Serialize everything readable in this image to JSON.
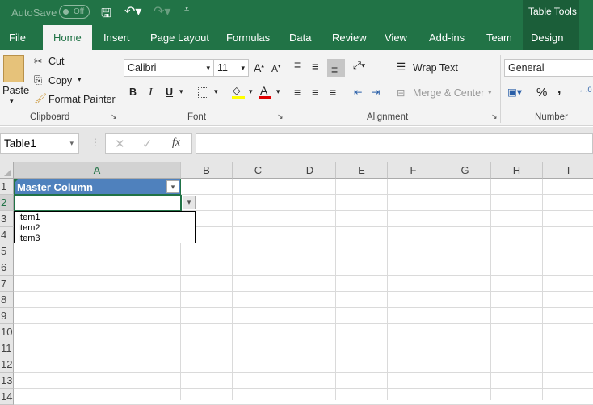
{
  "titlebar": {
    "autosave_label": "AutoSave",
    "autosave_state": "Off",
    "context_title": "Table Tools"
  },
  "tabs": [
    "File",
    "Home",
    "Insert",
    "Page Layout",
    "Formulas",
    "Data",
    "Review",
    "View",
    "Add-ins",
    "Team",
    "Design"
  ],
  "ribbon": {
    "clipboard": {
      "paste": "Paste",
      "cut": "Cut",
      "copy": "Copy",
      "format_painter": "Format Painter",
      "label": "Clipboard"
    },
    "font": {
      "name": "Calibri",
      "size": "11",
      "bold": "B",
      "italic": "I",
      "underline": "U",
      "label": "Font"
    },
    "alignment": {
      "wrap_text": "Wrap Text",
      "merge_center": "Merge & Center",
      "label": "Alignment"
    },
    "number": {
      "format": "General",
      "percent": "%",
      "comma": ",",
      "label": "Number"
    }
  },
  "formula_bar": {
    "name_box": "Table1",
    "fx": "fx",
    "value": ""
  },
  "columns": [
    "A",
    "B",
    "C",
    "D",
    "E",
    "F",
    "G",
    "H",
    "I"
  ],
  "rows": [
    "1",
    "2",
    "3",
    "4",
    "5",
    "6",
    "7",
    "8",
    "9",
    "10",
    "11",
    "12",
    "13",
    "14"
  ],
  "cells": {
    "A1": "Master Column",
    "A2": ""
  },
  "dropdown": {
    "items": [
      "Item1",
      "Item2",
      "Item3"
    ]
  },
  "colors": {
    "brand": "#217346",
    "table_header": "#4f81bd"
  }
}
